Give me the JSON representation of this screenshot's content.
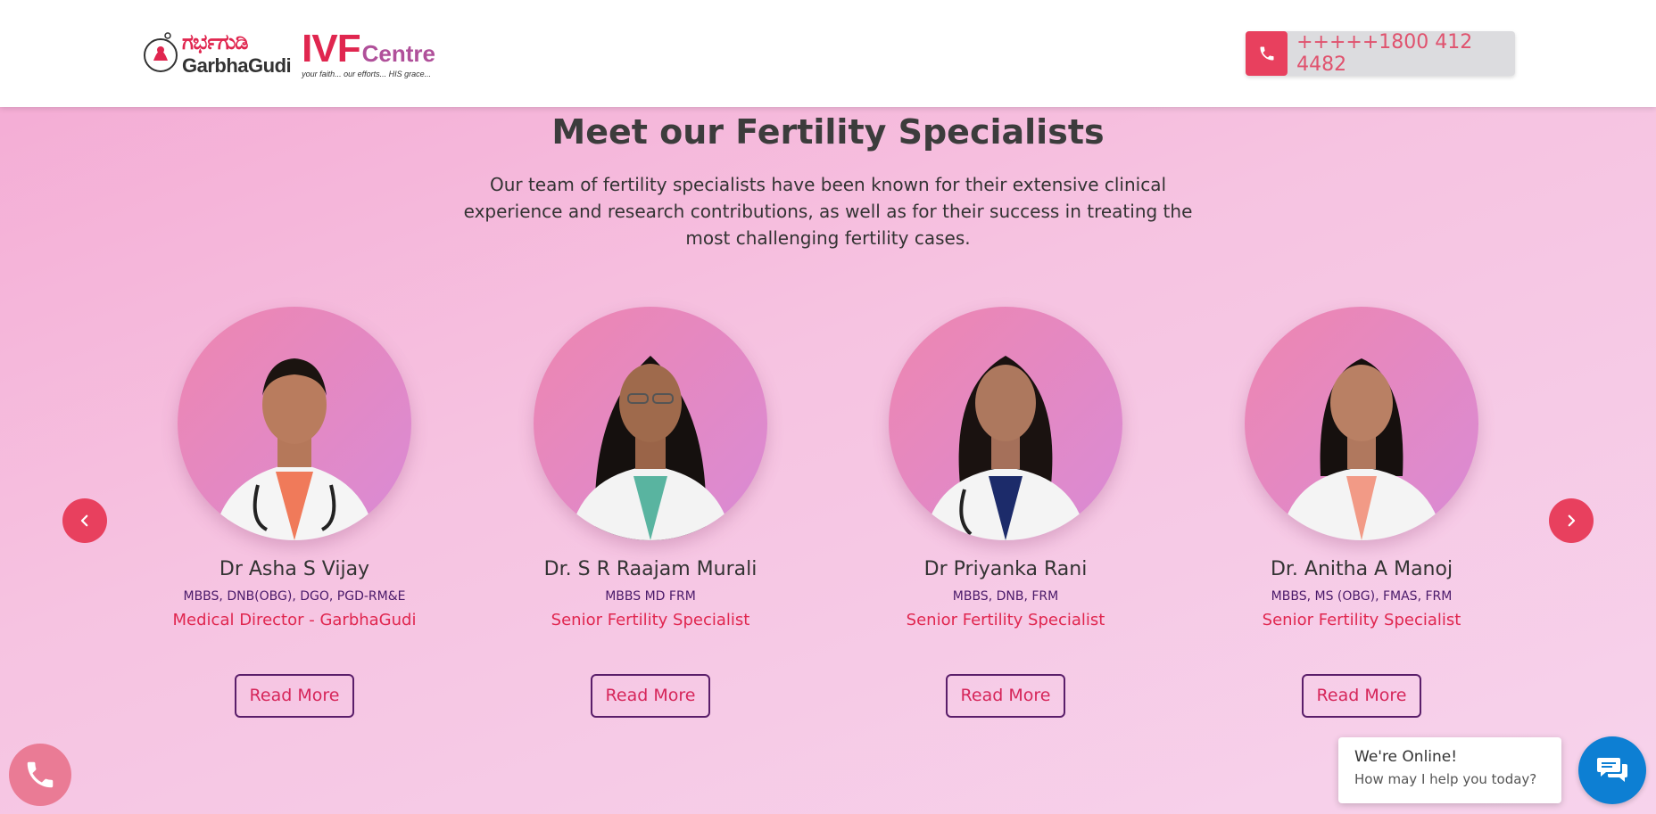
{
  "header": {
    "logo": {
      "kannada_text": "ಗರ್ಭಗುಡಿ",
      "brand_name": "GarbhaGudi",
      "ivf_big": "IVF",
      "ivf_small": "Centre",
      "tagline": "your faith... our efforts... HIS grace..."
    },
    "phone": {
      "number": "+++++1800 412 4482",
      "icon": "phone-icon"
    }
  },
  "section": {
    "title": "Meet our Fertility Specialists",
    "intro": "Our team of fertility specialists have been known for their extensive clinical experience and research contributions, as well as for their success in treating the most challenging fertility cases."
  },
  "carousel": {
    "prev_icon": "chevron-left-icon",
    "next_icon": "chevron-right-icon",
    "doctors": [
      {
        "name": "Dr Asha S Vijay",
        "qualifications": "MBBS, DNB(OBG), DGO, PGD-RM&E",
        "role": "Medical Director - GarbhaGudi",
        "button": "Read More"
      },
      {
        "name": "Dr. S R Raajam Murali",
        "qualifications": "MBBS MD FRM",
        "role": "Senior Fertility Specialist",
        "button": "Read More"
      },
      {
        "name": "Dr Priyanka Rani",
        "qualifications": "MBBS, DNB, FRM",
        "role": "Senior Fertility Specialist",
        "button": "Read More"
      },
      {
        "name": "Dr. Anitha A Manoj",
        "qualifications": "MBBS, MS (OBG), FMAS, FRM",
        "role": "Senior Fertility Specialist",
        "button": "Read More"
      }
    ]
  },
  "chat": {
    "title": "We're Online!",
    "subtitle": "How may I help you today?",
    "icon": "chat-icon"
  },
  "floating_call": {
    "icon": "phone-icon"
  },
  "colors": {
    "accent": "#e8405e",
    "chat_blue": "#0d7fd3",
    "button_border": "#5a1e6a"
  }
}
